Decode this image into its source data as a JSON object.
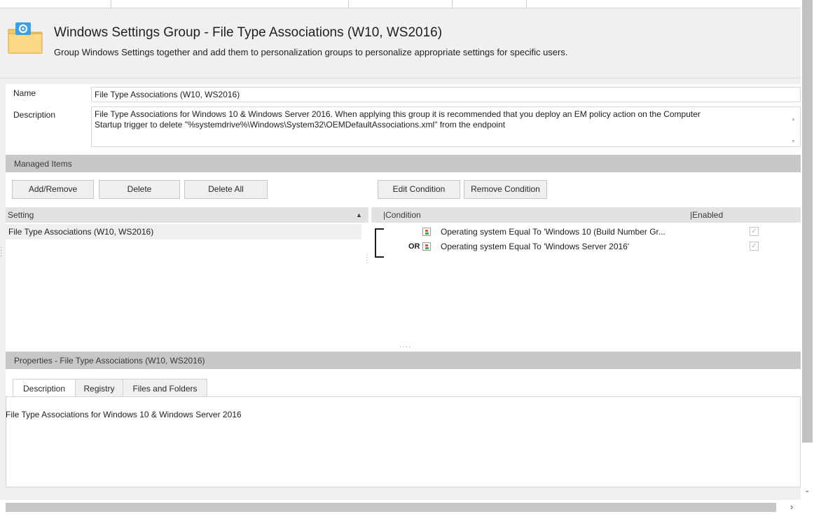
{
  "header": {
    "title": "Windows Settings Group - File Type Associations (W10, WS2016)",
    "subtitle": "Group Windows Settings together and add them to personalization groups to personalize appropriate settings for specific users."
  },
  "form": {
    "name_label": "Name",
    "name_value": "File Type Associations (W10, WS2016)",
    "description_label": "Description",
    "description_line1": "File Type Associations for Windows 10 & Windows Server 2016. When applying this group it is recommended that you deploy an EM policy action on the Computer",
    "description_line2": "Startup trigger to delete \"%systemdrive%\\Windows\\System32\\OEMDefaultAssociations.xml\" from the endpoint"
  },
  "managed_items": {
    "section_title": "Managed Items",
    "buttons": {
      "add_remove": "Add/Remove",
      "delete": "Delete",
      "delete_all": "Delete All",
      "edit_condition": "Edit Condition",
      "remove_condition": "Remove Condition"
    },
    "settings_grid": {
      "column_setting": "Setting",
      "sort_indicator": "▲",
      "rows": [
        "File Type Associations (W10, WS2016)"
      ]
    },
    "conditions_grid": {
      "column_condition": "|Condition",
      "column_enabled": "|Enabled",
      "rows": [
        {
          "operator": "",
          "text": "Operating system Equal To 'Windows 10 (Build Number Gr...",
          "enabled": true
        },
        {
          "operator": "OR",
          "text": "Operating system Equal To 'Windows Server 2016'",
          "enabled": true
        }
      ]
    }
  },
  "properties": {
    "section_title": "Properties - File Type Associations (W10, WS2016)",
    "tabs": [
      "Description",
      "Registry",
      "Files and Folders"
    ],
    "active_tab": "Description",
    "body_text": "File Type Associations for Windows 10 & Windows Server 2016"
  },
  "icons": {
    "folder": "folder-gear-icon",
    "condition": "condition-icon",
    "check": "checkmark"
  },
  "colors": {
    "section_bar": "#c8c8c8",
    "folder": "#f7c86a",
    "folder_tab": "#3ba0e6"
  }
}
